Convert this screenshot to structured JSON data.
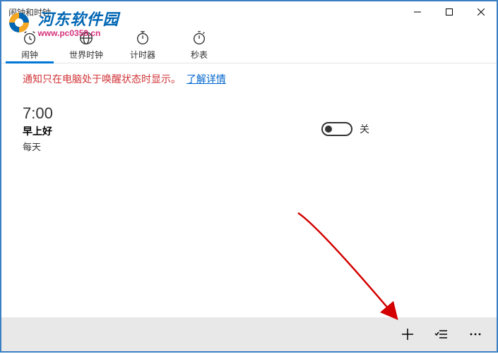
{
  "window": {
    "title": "闹钟和时钟"
  },
  "watermark": {
    "text": "河东软件园",
    "url": "www.pc0359.cn"
  },
  "tabs": [
    {
      "label": "闹钟",
      "icon": "alarm"
    },
    {
      "label": "世界时钟",
      "icon": "world-clock"
    },
    {
      "label": "计时器",
      "icon": "timer"
    },
    {
      "label": "秒表",
      "icon": "stopwatch"
    }
  ],
  "notice": {
    "text": "通知只在电脑处于唤醒状态时显示。",
    "link": "了解详情"
  },
  "alarms": [
    {
      "time": "7:00",
      "name": "早上好",
      "repeat": "每天",
      "enabled": false,
      "state_label": "关"
    }
  ]
}
